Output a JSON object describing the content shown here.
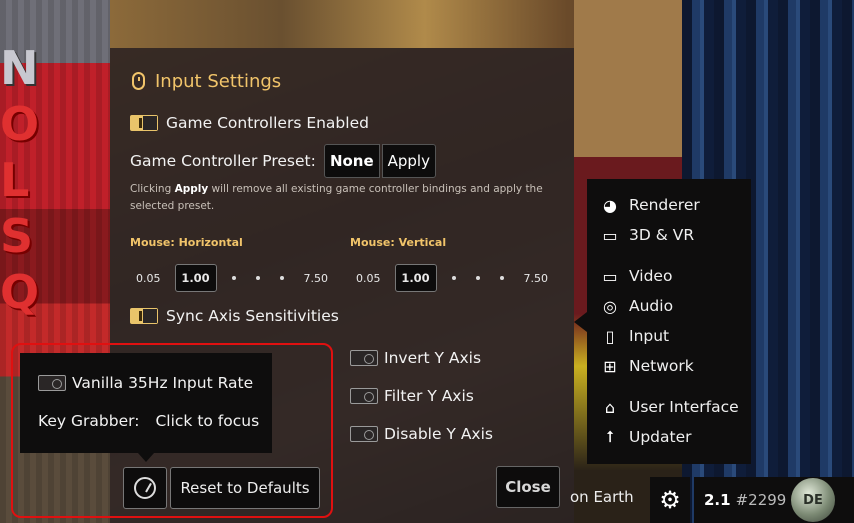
{
  "dialog": {
    "title": "Input Settings",
    "game_controllers_enabled": "Game Controllers Enabled",
    "controller_preset_label": "Game Controller Preset:",
    "preset_value": "None",
    "apply_button": "Apply",
    "hint_prefix": "Clicking ",
    "hint_bold": "Apply",
    "hint_suffix": " will remove all existing game controller bindings and apply the selected preset.",
    "mouse_horizontal": {
      "label": "Mouse: Horizontal",
      "min": "0.05",
      "value": "1.00",
      "max": "7.50"
    },
    "mouse_vertical": {
      "label": "Mouse: Vertical",
      "min": "0.05",
      "value": "1.00",
      "max": "7.50"
    },
    "sync_axis": "Sync Axis Sensitivities",
    "invert_y": "Invert Y Axis",
    "filter_y": "Filter Y Axis",
    "disable_y": "Disable Y Axis",
    "close_button": "Close"
  },
  "popup": {
    "vanilla_rate": "Vanilla 35Hz Input Rate",
    "key_grabber_label": "Key Grabber:",
    "key_grabber_value": "Click to focus"
  },
  "footer": {
    "reset_button": "Reset to Defaults"
  },
  "menu": {
    "items": [
      {
        "label": "Renderer",
        "icon": "renderer-icon"
      },
      {
        "label": "3D & VR",
        "icon": "vr-goggles-icon"
      },
      {
        "label": "Video",
        "icon": "monitor-icon"
      },
      {
        "label": "Audio",
        "icon": "speaker-icon"
      },
      {
        "label": "Input",
        "icon": "mouse-icon"
      },
      {
        "label": "Network",
        "icon": "network-icon"
      },
      {
        "label": "User Interface",
        "icon": "home-icon"
      },
      {
        "label": "Updater",
        "icon": "upload-arrow-icon"
      }
    ]
  },
  "taskbar": {
    "game_text": "on Earth",
    "version": "2.1",
    "build": "#2299",
    "logo_text": "DE"
  },
  "colors": {
    "accent": "#f1c46a",
    "highlight_outline": "#e01010",
    "panel": "#0e0d0d"
  }
}
